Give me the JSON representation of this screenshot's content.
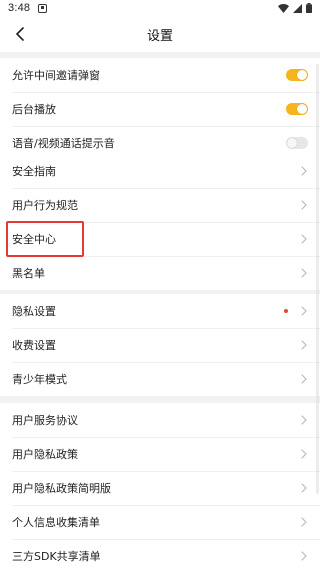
{
  "status_bar": {
    "time": "3:48"
  },
  "header": {
    "title": "设置"
  },
  "sections": {
    "toggles": [
      {
        "label": "允许中间邀请弹窗",
        "state": "on"
      },
      {
        "label": "后台播放",
        "state": "on"
      },
      {
        "label": "语音/视频通话提示音",
        "state": "off"
      }
    ],
    "safety": [
      {
        "label": "安全指南"
      },
      {
        "label": "用户行为规范"
      },
      {
        "label": "安全中心"
      },
      {
        "label": "黑名单"
      }
    ],
    "privacy": [
      {
        "label": "隐私设置",
        "has_red_dot": true
      },
      {
        "label": "收费设置"
      },
      {
        "label": "青少年模式"
      }
    ],
    "agreements": [
      {
        "label": "用户服务协议"
      },
      {
        "label": "用户隐私政策"
      },
      {
        "label": "用户隐私政策简明版"
      },
      {
        "label": "个人信息收集清单"
      },
      {
        "label": "三方SDK共享清单"
      }
    ]
  },
  "colors": {
    "accent": "#f5b51c",
    "toggle_off": "#e6e6e6",
    "red_dot": "#e9453a",
    "highlight": "#e53935",
    "background": "#f2f2f2"
  }
}
